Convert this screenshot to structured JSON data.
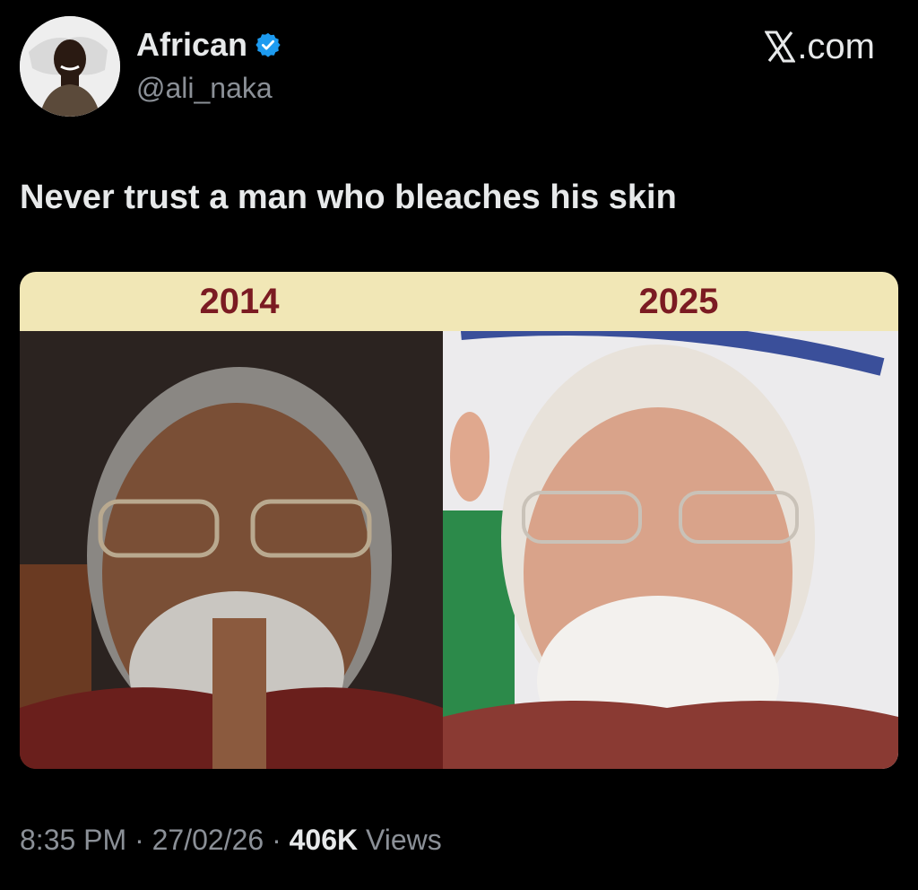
{
  "author": {
    "display_name": "African",
    "handle": "@ali_naka",
    "avatar": "avatar-photo",
    "verified": "verified-badge-icon"
  },
  "brand": {
    "suffix": ".com",
    "icon": "x-logo-icon"
  },
  "tweet": {
    "text": "Never trust a man who bleaches his skin"
  },
  "media": {
    "labels": [
      "2014",
      "2025"
    ],
    "label_bar_color": "#f1e7b6",
    "label_text_color": "#7b1b22"
  },
  "meta": {
    "time": "8:35 PM",
    "separator": "·",
    "date": "27/02/26",
    "views_count": "406K",
    "views_label": "Views"
  },
  "colors": {
    "background": "#000000",
    "text": "#e7e9ea",
    "secondary": "#8b9097",
    "verified": "#1d9bf0"
  }
}
